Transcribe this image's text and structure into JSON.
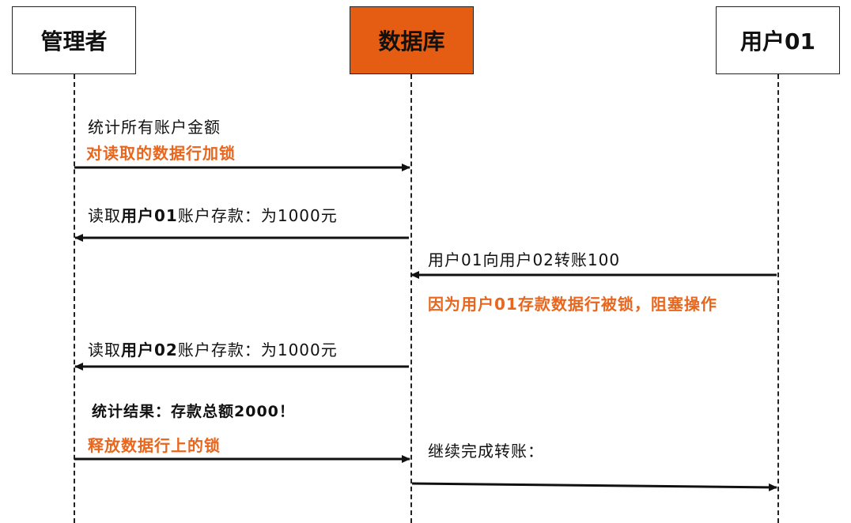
{
  "actors": {
    "admin": "管理者",
    "database": "数据库",
    "user01": "用户01"
  },
  "messages": {
    "m1_line1": "统计所有账户金额",
    "m1_line2": "对读取的数据行加锁",
    "m2_prefix": "读取",
    "m2_user": "用户01",
    "m2_suffix": "账户存款：为1000元",
    "m3": "用户01向用户02转账100",
    "m3_note": "因为用户01存款数据行被锁，阻塞操作",
    "m4_prefix": "读取",
    "m4_user": "用户02",
    "m4_suffix": "账户存款：为1000元",
    "m5": "统计结果：存款总额2000！",
    "m6": "释放数据行上的锁",
    "m7": "继续完成转账："
  },
  "colors": {
    "accent": "#e45d12",
    "note_text": "#e8661d",
    "line": "#222222"
  }
}
